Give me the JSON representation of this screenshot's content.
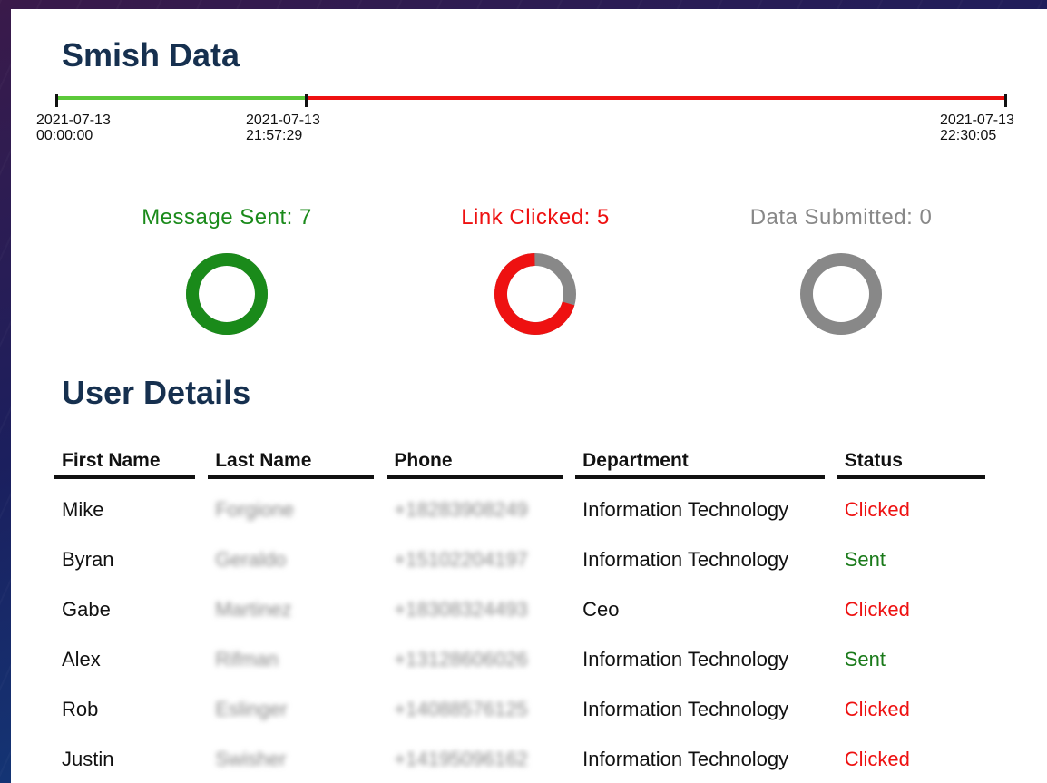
{
  "title": "Smish Data",
  "timeline": {
    "start": {
      "date": "2021-07-13",
      "time": "00:00:00"
    },
    "mid": {
      "date": "2021-07-13",
      "time": "21:57:29"
    },
    "end": {
      "date": "2021-07-13",
      "time": "22:30:05"
    },
    "colors": {
      "sent_segment": "#5cc93a",
      "clicked_segment": "#ee1111"
    }
  },
  "metrics": [
    {
      "label": "Message Sent",
      "value": "7",
      "color": "#1a8a1a",
      "fraction": 1.0
    },
    {
      "label": "Link Clicked",
      "value": "5",
      "color": "#ee1111",
      "fraction": 0.7143
    },
    {
      "label": "Data Submitted",
      "value": "0",
      "color": "#888888",
      "fraction": 0.0
    }
  ],
  "user_details": {
    "title": "User Details",
    "columns": [
      "First Name",
      "Last Name",
      "Phone",
      "Department",
      "Status"
    ],
    "rows": [
      {
        "first": "Mike",
        "last": "Forgione",
        "phone": "+18283908249",
        "department": "Information Technology",
        "status": "Clicked"
      },
      {
        "first": "Byran",
        "last": "Geraldo",
        "phone": "+15102204197",
        "department": "Information Technology",
        "status": "Sent"
      },
      {
        "first": "Gabe",
        "last": "Martinez",
        "phone": "+18308324493",
        "department": "Ceo",
        "status": "Clicked"
      },
      {
        "first": "Alex",
        "last": "Rifman",
        "phone": "+13128606026",
        "department": "Information Technology",
        "status": "Sent"
      },
      {
        "first": "Rob",
        "last": "Eslinger",
        "phone": "+14088576125",
        "department": "Information Technology",
        "status": "Clicked"
      },
      {
        "first": "Justin",
        "last": "Swisher",
        "phone": "+14195096162",
        "department": "Information Technology",
        "status": "Clicked"
      }
    ]
  }
}
